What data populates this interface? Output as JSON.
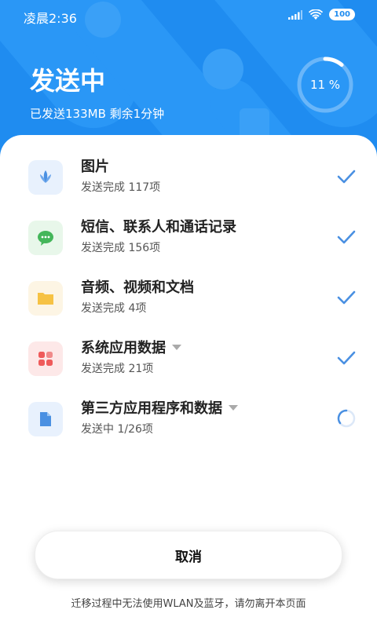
{
  "status_bar": {
    "time": "凌晨2:36",
    "battery": "100"
  },
  "header": {
    "title": "发送中",
    "subtitle": "已发送133MB 剩余1分钟",
    "progress_label": "11 %",
    "progress_fraction": 0.11
  },
  "items": [
    {
      "name": "图片",
      "status": "发送完成 117项",
      "icon": "image-icon",
      "state": "done"
    },
    {
      "name": "短信、联系人和通话记录",
      "status": "发送完成 156项",
      "icon": "message-icon",
      "state": "done"
    },
    {
      "name": "音频、视频和文档",
      "status": "发送完成 4项",
      "icon": "folder-icon",
      "state": "done"
    },
    {
      "name": "系统应用数据",
      "status": "发送完成 21项",
      "icon": "apps-icon",
      "state": "done"
    },
    {
      "name": "第三方应用程序和数据",
      "status": "发送中 1/26项",
      "icon": "file-icon",
      "state": "sending"
    }
  ],
  "cancel_label": "取消",
  "footer_note": "迁移过程中无法使用WLAN及蓝牙，请勿离开本页面",
  "colors": {
    "accent": "#1f8cf0",
    "check": "#4a90e2"
  }
}
